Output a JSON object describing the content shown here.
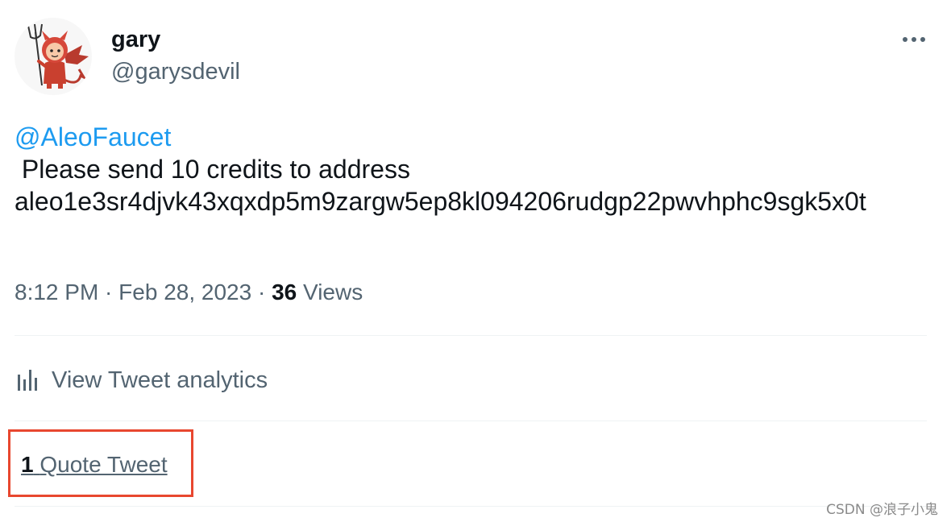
{
  "author": {
    "display_name": "gary",
    "handle": "@garysdevil",
    "avatar_icon": "devil-cartoon-avatar-icon"
  },
  "tweet": {
    "mention": "@AleoFaucet",
    "text_line": " Please send 10 credits to address",
    "address": "aleo1e3sr4djvk43xqxdp5m9zargw5ep8kl094206rudgp22pwvhphc9sgk5x0t",
    "time": "8:12 PM",
    "separator": " · ",
    "date": "Feb 28, 2023",
    "views_count": "36",
    "views_label": "Views"
  },
  "actions": {
    "analytics_label": "View Tweet analytics",
    "analytics_icon": "bar-chart-icon",
    "quote_count": "1",
    "quote_label": "Quote Tweet",
    "more_icon": "more-options-icon"
  },
  "watermark": "CSDN @浪子小鬼",
  "colors": {
    "link": "#1d9bf0",
    "secondary_text": "#536471",
    "primary_text": "#0f1419",
    "highlight_box": "#e8472f"
  }
}
